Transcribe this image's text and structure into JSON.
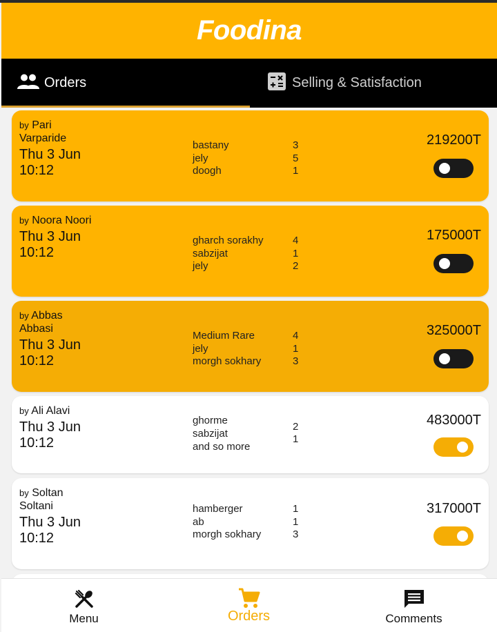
{
  "app": {
    "title": "Foodina"
  },
  "tabs": [
    {
      "label": "Orders",
      "icon": "people-icon"
    },
    {
      "label": "Selling & Satisfaction",
      "icon": "calculator-icon"
    }
  ],
  "orders": [
    {
      "by": "by",
      "name": "Pari Varparide",
      "date": "Thu 3 Jun 10:12",
      "items": [
        {
          "name": "bastany",
          "qty": "3"
        },
        {
          "name": "jely",
          "qty": "5"
        },
        {
          "name": "doogh",
          "qty": "1"
        }
      ],
      "price": "219200T",
      "active": false
    },
    {
      "by": "by",
      "name": "Noora Noori",
      "date": "Thu 3 Jun 10:12",
      "items": [
        {
          "name": "gharch sorakhy",
          "qty": "4"
        },
        {
          "name": "sabzijat",
          "qty": "1"
        },
        {
          "name": "jely",
          "qty": "2"
        }
      ],
      "price": "175000T",
      "active": false
    },
    {
      "by": "by",
      "name": "Abbas Abbasi",
      "date": "Thu 3 Jun 10:12",
      "items": [
        {
          "name": "Medium Rare",
          "qty": "4"
        },
        {
          "name": "jely",
          "qty": "1"
        },
        {
          "name": "morgh sokhary",
          "qty": "3"
        }
      ],
      "price": "325000T",
      "active": false
    },
    {
      "by": "by",
      "name": "Ali Alavi",
      "date": "Thu 3 Jun 10:12",
      "item_names": [
        "ghorme",
        "sabzijat",
        "and so more"
      ],
      "item_qtys": [
        "2",
        "1"
      ],
      "price": "483000T",
      "active": true
    },
    {
      "by": "by",
      "name": "Soltan Soltani",
      "date": "Thu 3 Jun 10:12",
      "items": [
        {
          "name": "hamberger",
          "qty": "1"
        },
        {
          "name": "ab",
          "qty": "1"
        },
        {
          "name": "morgh sokhary",
          "qty": "3"
        }
      ],
      "price": "317000T",
      "active": true
    }
  ],
  "bottom_nav": [
    {
      "label": "Menu",
      "icon": "fork-spoon-icon"
    },
    {
      "label": "Orders",
      "icon": "cart-icon",
      "active": true
    },
    {
      "label": "Comments",
      "icon": "comment-icon"
    }
  ],
  "colors": {
    "accent": "#ffb300",
    "accent_dark": "#f5ad05",
    "tabbar": "#000000"
  }
}
